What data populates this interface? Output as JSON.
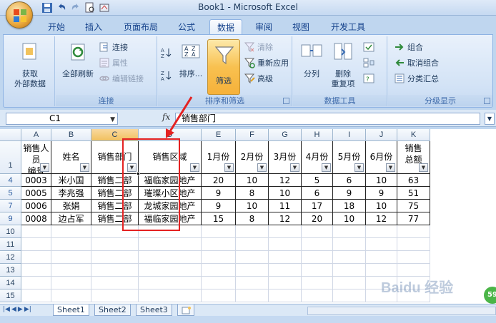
{
  "window": {
    "title": "Book1 - Microsoft Excel"
  },
  "tabs": [
    "开始",
    "插入",
    "页面布局",
    "公式",
    "数据",
    "审阅",
    "视图",
    "开发工具"
  ],
  "active_tab": "数据",
  "ribbon": {
    "get_external": "获取\n外部数据",
    "refresh_all": "全部刷新",
    "connections": "连接",
    "properties": "属性",
    "edit_links": "编辑链接",
    "group_connections": "连接",
    "sort_az": "A↓Z",
    "sort_za": "Z↓A",
    "sort": "排序...",
    "filter": "筛选",
    "clear": "清除",
    "reapply": "重新应用",
    "advanced": "高级",
    "group_sort_filter": "排序和筛选",
    "text_to_columns": "分列",
    "remove_dup": "删除\n重复项",
    "group_data_tools": "数据工具",
    "group": "组合",
    "ungroup": "取消组合",
    "subtotal": "分类汇总",
    "group_outline": "分级显示"
  },
  "formula_bar": {
    "name_box": "C1",
    "fx": "fx",
    "content": "销售部门"
  },
  "columns": [
    "A",
    "B",
    "C",
    "D",
    "E",
    "F",
    "G",
    "H",
    "I",
    "J",
    "K"
  ],
  "header_row_label": "1",
  "headers": [
    "销售人员\n编号",
    "姓名",
    "销售部门",
    "销售区域",
    "1月份",
    "2月份",
    "3月份",
    "4月份",
    "5月份",
    "6月份",
    "销售\n总额"
  ],
  "rows": [
    {
      "row": "4",
      "cells": [
        "0003",
        "米小国",
        "销售二部",
        "福临家园地产",
        "20",
        "10",
        "12",
        "5",
        "6",
        "10",
        "63"
      ]
    },
    {
      "row": "5",
      "cells": [
        "0005",
        "李兆强",
        "销售二部",
        "璀璨小区地产",
        "9",
        "8",
        "10",
        "6",
        "9",
        "9",
        "51"
      ]
    },
    {
      "row": "7",
      "cells": [
        "0006",
        "张娟",
        "销售二部",
        "龙城家园地产",
        "9",
        "10",
        "11",
        "17",
        "18",
        "10",
        "75"
      ]
    },
    {
      "row": "9",
      "cells": [
        "0008",
        "边占军",
        "销售二部",
        "福临家园地产",
        "15",
        "8",
        "12",
        "20",
        "10",
        "12",
        "77"
      ]
    }
  ],
  "empty_rows": [
    "10",
    "11",
    "12",
    "13",
    "14",
    "15"
  ],
  "sheets": [
    "Sheet1",
    "Sheet2",
    "Sheet3"
  ],
  "active_sheet": "Sheet1",
  "watermark": "Baidu 经验",
  "badge": "59"
}
